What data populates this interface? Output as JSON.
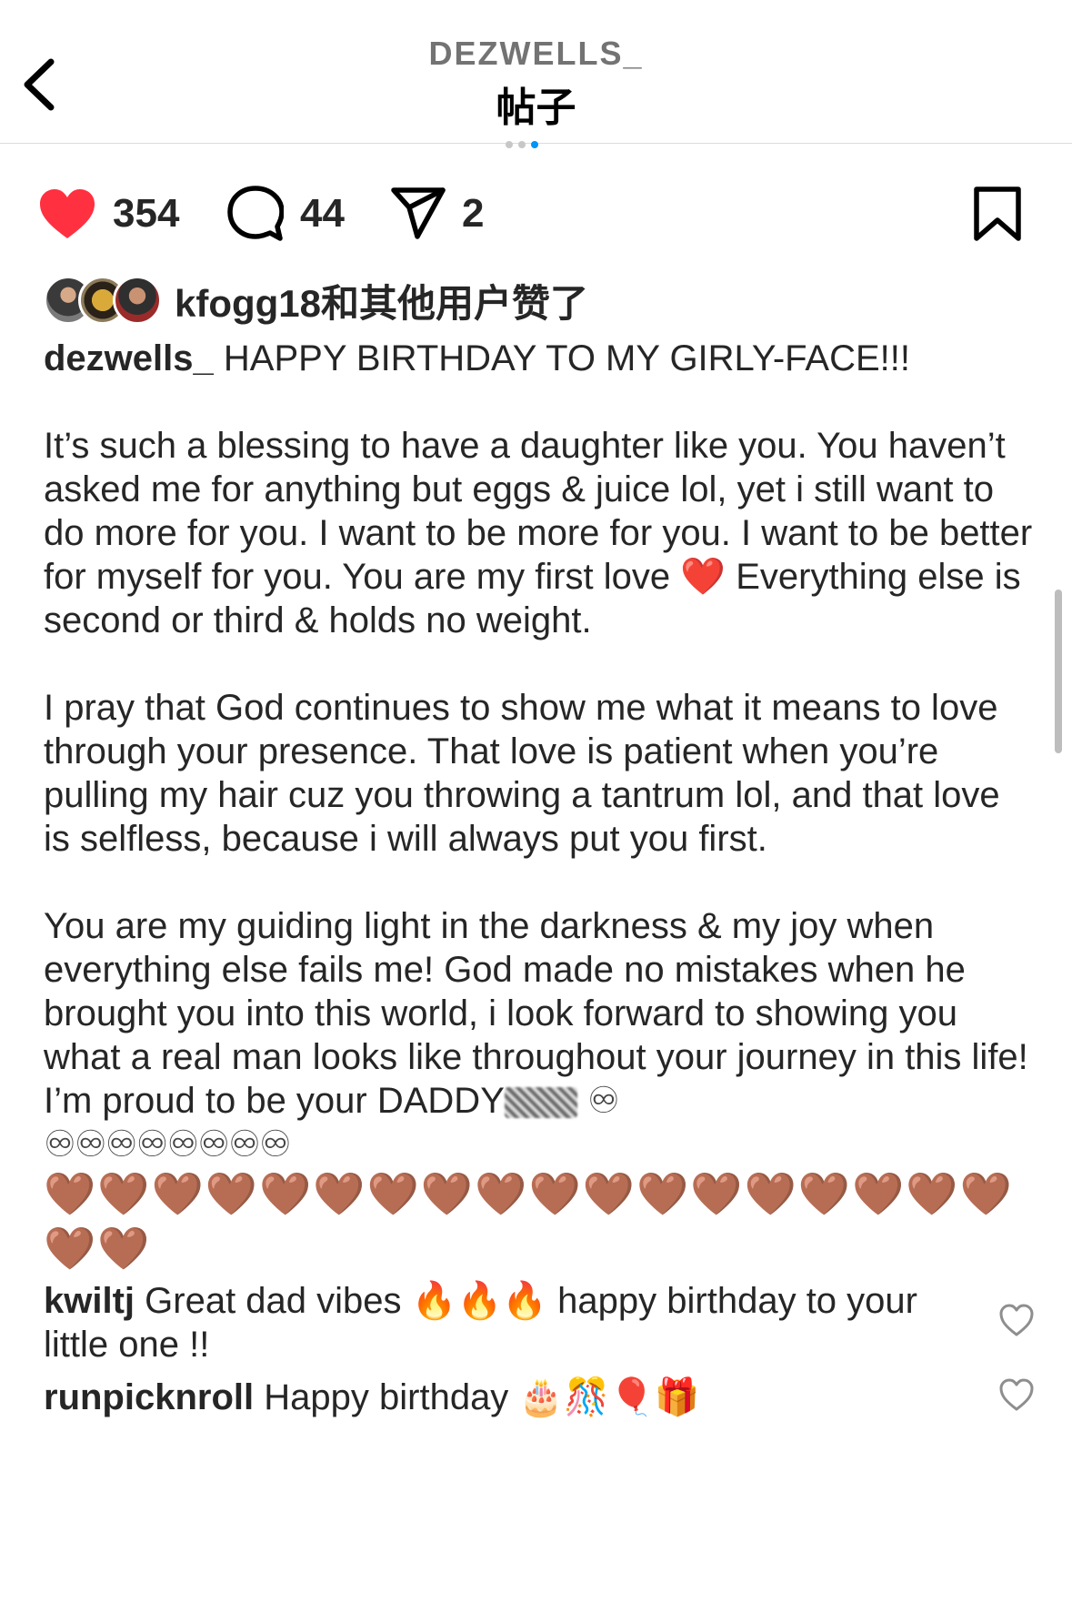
{
  "header": {
    "username": "DEZWELLS_",
    "title": "帖子"
  },
  "actions": {
    "likes": "354",
    "comments": "44",
    "shares": "2"
  },
  "liked_by": {
    "username": "kfogg18",
    "suffix": "和其他用户赞了"
  },
  "caption": {
    "username": "dezwells_",
    "line1": "HAPPY BIRTHDAY TO MY GIRLY-FACE!!!",
    "para1": "It’s such a blessing to have a daughter like you. You haven’t asked me for anything but eggs & juice lol, yet i still want to do more for you. I want to be more for you. I want to be better for myself for you. You are my first love ❤️ Everything else is second or third & holds no weight.",
    "para2": "I pray that God continues to show me what it means to love through your presence. That love is patient when you’re pulling my hair cuz you throwing a tantrum lol, and that love is selfless, because i will always put you first.",
    "para3": "You are my guiding light in the darkness & my joy when everything else fails me! God made no mistakes when he brought you into this world, i look forward to showing you what a real man looks like throughout your journey in this life!",
    "closing": "I’m proud to be your DADDY",
    "infinity_line1": "♾",
    "infinity_line2": "♾♾♾♾♾♾♾♾",
    "hearts": "🤎🤎🤎🤎🤎🤎🤎🤎🤎🤎🤎🤎🤎🤎🤎🤎🤎🤎🤎🤎"
  },
  "comments": [
    {
      "username": "kwiltj",
      "text": "Great dad vibes 🔥🔥🔥 happy birthday to your little one !!"
    },
    {
      "username": "runpicknroll",
      "text": "Happy birthday 🎂🎊🎈🎁"
    }
  ],
  "colors": {
    "like_red": "#ff3040",
    "text": "#262626",
    "muted": "#737373"
  },
  "icons": [
    "back-chevron-icon",
    "heart-filled-icon",
    "comment-icon",
    "share-icon",
    "bookmark-icon",
    "comment-like-icon"
  ]
}
